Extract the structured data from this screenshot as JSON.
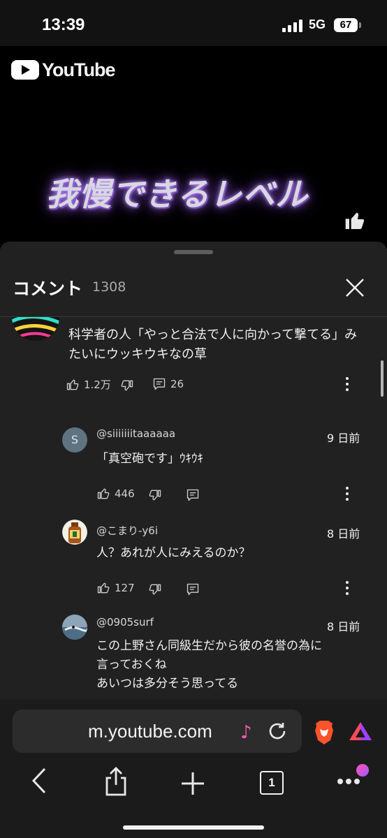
{
  "status": {
    "time": "13:39",
    "network": "5G",
    "battery": "67"
  },
  "video": {
    "logo_text": "YouTube",
    "caption": "我慢できるレベル"
  },
  "comments": {
    "title": "コメント",
    "count": "1308",
    "main": {
      "text": "科学者の人「やっと合法で人に向かって撃てる」みたいにウッキウキなの草",
      "likes": "1.2万",
      "replies": "26"
    },
    "replies": [
      {
        "avatar_letter": "S",
        "author": "@siiiiiiitaaaaaa",
        "date": "9 日前",
        "text": "「真空砲です」ｳｷｳｷ",
        "likes": "446"
      },
      {
        "author": "@こまり-y6i",
        "date": "8 日前",
        "text": "人？あれが人にみえるのか？",
        "likes": "127"
      },
      {
        "author": "@0905surf",
        "date": "8 日前",
        "lines": [
          "この上野さん同級生だから彼の名誉の為に",
          "言っておくね",
          "あいつは多分そう思ってる"
        ]
      }
    ]
  },
  "browser": {
    "url": "m.youtube.com",
    "tab_count": "1"
  },
  "colors": {
    "sheet_bg": "#212121",
    "page_bg": "#0f0f0f",
    "accent_pink": "#ff5bb0",
    "brave_orange": "#fb542b"
  },
  "icons": [
    "signal-icon",
    "battery-icon",
    "youtube-logo-icon",
    "thumbs-up-icon",
    "thumbs-down-icon",
    "comment-icon",
    "more-vert-icon",
    "close-icon",
    "music-icon",
    "reload-icon",
    "brave-lion-icon",
    "triangle-icon",
    "back-icon",
    "share-icon",
    "plus-icon",
    "tabs-icon",
    "more-horiz-icon"
  ]
}
